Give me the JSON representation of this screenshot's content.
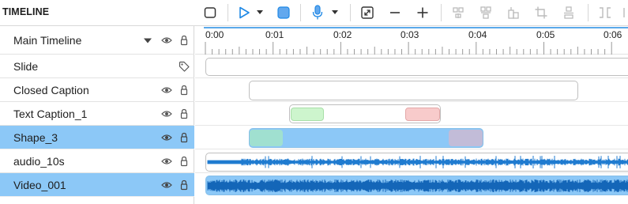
{
  "header": {
    "title": "TIMELINE",
    "toolbar": [
      {
        "name": "fit-to-screen-button",
        "icon": "frame-icon"
      },
      {
        "name": "play-button",
        "icon": "play-icon"
      },
      {
        "name": "play-options-dropdown",
        "icon": "caret-down-icon"
      },
      {
        "name": "stop-button",
        "icon": "stop-icon"
      },
      {
        "name": "record-audio-button",
        "icon": "microphone-icon"
      },
      {
        "name": "record-options-dropdown",
        "icon": "caret-down-icon"
      },
      {
        "name": "expand-button",
        "icon": "expand-icon"
      },
      {
        "name": "zoom-out-button",
        "icon": "minus-icon"
      },
      {
        "name": "zoom-in-button",
        "icon": "plus-icon"
      },
      {
        "name": "align-left-button",
        "icon": "align-left-icon"
      },
      {
        "name": "align-center-button",
        "icon": "align-center-icon"
      },
      {
        "name": "align-right-button",
        "icon": "align-right-icon"
      },
      {
        "name": "crop-button",
        "icon": "crop-icon"
      },
      {
        "name": "split-button",
        "icon": "split-icon"
      },
      {
        "name": "trim-button",
        "icon": "trim-icon"
      }
    ]
  },
  "tracks": [
    {
      "name": "Main Timeline",
      "selected": false,
      "controls": [
        "dropdown",
        "eye",
        "lock"
      ]
    },
    {
      "name": "Slide",
      "selected": false,
      "controls": [
        "tag"
      ]
    },
    {
      "name": "Closed Caption",
      "selected": false,
      "controls": [
        "eye",
        "lock"
      ]
    },
    {
      "name": "Text Caption_1",
      "selected": false,
      "controls": [
        "eye",
        "lock"
      ]
    },
    {
      "name": "Shape_3",
      "selected": true,
      "controls": [
        "eye",
        "lock"
      ]
    },
    {
      "name": "audio_10s",
      "selected": false,
      "controls": [
        "eye",
        "lock"
      ]
    },
    {
      "name": "Video_001",
      "selected": true,
      "controls": [
        "eye",
        "lock"
      ]
    }
  ],
  "ruler": {
    "labels": [
      "0:00",
      "0:01",
      "0:02",
      "0:03",
      "0:04",
      "0:05",
      "0:06"
    ]
  },
  "colors": {
    "accent": "#1e88e5",
    "selected_row": "#8cc8f7",
    "waveform": "#1f7bd0",
    "caption_start": "#cdf5cd",
    "caption_end": "#f8cbcb",
    "shape_start": "#a0e0d0",
    "shape_end": "#c2bcd8"
  }
}
